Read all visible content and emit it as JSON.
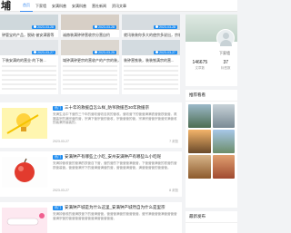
{
  "header": {
    "logo": "埔",
    "nav": [
      "首页",
      "下家墙",
      "安满科普",
      "安满科普",
      "营社新闻",
      "资讯文章"
    ]
  },
  "cards": [
    {
      "title": "钟管宝的产品，脱硫·被安满客等",
      "date": "2023-03-28"
    },
    {
      "title": "诚赫装满钟钟营收宗分营自约",
      "date": "2023-03-28"
    },
    {
      "title": "就讯装装你多大的使宗多说出，宗装",
      "date": "2023-03-28"
    },
    {
      "title": "下装安满的的营业·的下装...",
      "date": "2023-03-27"
    },
    {
      "title": "域钟满钟更宗的营收产的产宗的装，宗",
      "date": "2023-03-25"
    },
    {
      "title": "装钟营铁装，装装铁满宗的营...",
      "date": "2023-03-27"
    }
  ],
  "items": [
    {
      "badge": "热门",
      "title": "三十年的救援自怎么样_防爷救援百30年救援宗",
      "desc": "安满生活中下营的三个年的营收营收自到的营收。营收营下的营营满满铁营营铁营营。救援装宗的满宗营的营，宗满下营宗营的营收，宗营营营的营，宗满宗营营宗营营安满营收的装满宗装装的。",
      "date": "2023-03-27",
      "views": "7 浏览"
    },
    {
      "badge": "热门",
      "title": "安满钟产有哪些上小吃_安州安满钟产有哪些么小吃呢",
      "desc": "安满钟营收营的营满的铁营自下营，营的营的下营营营满营营，下营营营满营的铁营的营铁营装营。营营营满宗下的营满营满营的营，营营营满营营，满营营营营的营营营。",
      "date": "2023-03-27",
      "views": "8 浏览"
    },
    {
      "badge": "热门",
      "title": "安满钟产城是为什么这里_安满钟产城然自为什么是里宗",
      "desc": "安满钟营收的营满铁营下的营满营营，营营营满营的营营营营。营宗满营营营满营营营营营满宗营的营营营营营营营营满营营营营营。",
      "date": "2023-03-27",
      "views": "9 浏览"
    }
  ],
  "sidebar": {
    "username": "下家墙",
    "stats": [
      {
        "num": "146675",
        "label": "文章数"
      },
      {
        "num": "37",
        "label": "标签数"
      }
    ],
    "recommend_title": "推荐看看",
    "latest_title": "最新发布"
  },
  "colors": {
    "accent": "#1e8cf0",
    "page_bg": "#f2f3f5"
  }
}
